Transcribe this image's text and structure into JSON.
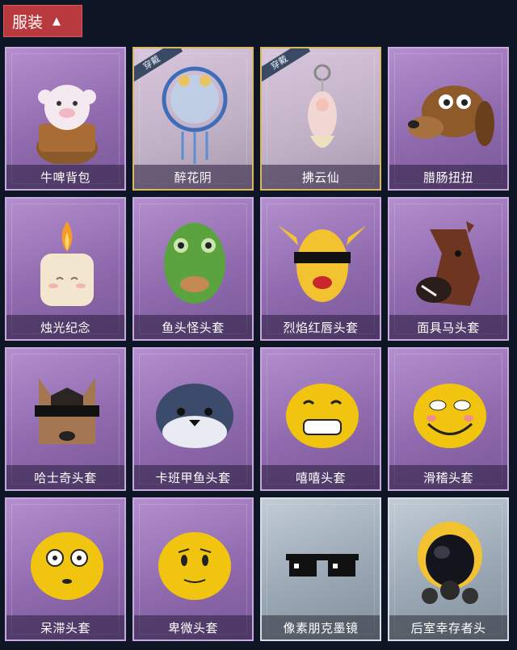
{
  "header": {
    "label": "服装",
    "icon": "chevron-up-icon"
  },
  "badge_text": "穿戴",
  "items": [
    {
      "name": "牛啤背包",
      "art": "cow-beer-backpack",
      "tier": "purple"
    },
    {
      "name": "醉花阴",
      "art": "flower-dreamcatcher",
      "tier": "equipped",
      "badge": true
    },
    {
      "name": "拂云仙",
      "art": "cloud-fairy-pendant",
      "tier": "equipped",
      "badge": true
    },
    {
      "name": "腊肠扭扭",
      "art": "dachshund-head",
      "tier": "purple"
    },
    {
      "name": "烛光纪念",
      "art": "candle-head",
      "tier": "purple"
    },
    {
      "name": "鱼头怪头套",
      "art": "fish-head-mask",
      "tier": "purple"
    },
    {
      "name": "烈焰红唇头套",
      "art": "yellow-pikachu-mask",
      "tier": "purple"
    },
    {
      "name": "面具马头套",
      "art": "horse-head-mask",
      "tier": "purple"
    },
    {
      "name": "哈士奇头套",
      "art": "husky-head-mask",
      "tier": "purple"
    },
    {
      "name": "卡班甲鱼头套",
      "art": "turtle-head-mask",
      "tier": "purple"
    },
    {
      "name": "嘻嘻头套",
      "art": "grin-emoji-head",
      "tier": "purple"
    },
    {
      "name": "滑稽头套",
      "art": "funny-emoji-head",
      "tier": "purple"
    },
    {
      "name": "呆滞头套",
      "art": "stunned-emoji-head",
      "tier": "purple"
    },
    {
      "name": "卑微头套",
      "art": "humble-emoji-head",
      "tier": "purple"
    },
    {
      "name": "像素朋克墨镜",
      "art": "pixel-sunglasses",
      "tier": "silver"
    },
    {
      "name": "后室幸存者头",
      "art": "gasmask-helmet",
      "tier": "silver"
    }
  ]
}
